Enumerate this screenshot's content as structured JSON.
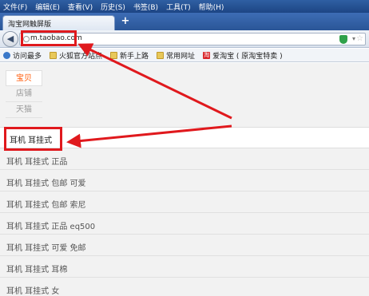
{
  "menubar": {
    "items": [
      "文件(F)",
      "编辑(E)",
      "查看(V)",
      "历史(S)",
      "书签(B)",
      "工具(T)",
      "帮助(H)"
    ]
  },
  "tab": {
    "title": "淘宝网触屏版",
    "new_tab_label": "+"
  },
  "nav": {
    "back_icon": "back-arrow-icon",
    "url": "m.taobao.com",
    "shield_color": "#2fa14a"
  },
  "bookmarks": {
    "items": [
      {
        "label": "访问最多",
        "icon": "globe-icon"
      },
      {
        "label": "火狐官方站点",
        "icon": "folder-icon"
      },
      {
        "label": "新手上路",
        "icon": "folder-icon"
      },
      {
        "label": "常用网址",
        "icon": "folder-icon"
      },
      {
        "label": "爱淘宝 ( 原淘宝特卖 )",
        "icon": "taobao-icon"
      }
    ]
  },
  "page": {
    "categories": [
      {
        "label": "宝贝",
        "active": true
      },
      {
        "label": "店铺",
        "active": false
      },
      {
        "label": "天猫",
        "active": false
      }
    ],
    "query": "耳机 耳挂式",
    "suggestions": [
      "耳机 耳挂式 正品",
      "耳机 耳挂式 包邮 可爱",
      "耳机 耳挂式 包邮 索尼",
      "耳机 耳挂式 正品 eq500",
      "耳机 耳挂式 可爱 免邮",
      "耳机 耳挂式 耳棉",
      "耳机 耳挂式 女"
    ],
    "accent_color": "#ff5500",
    "annotation_color": "#e0191d"
  }
}
